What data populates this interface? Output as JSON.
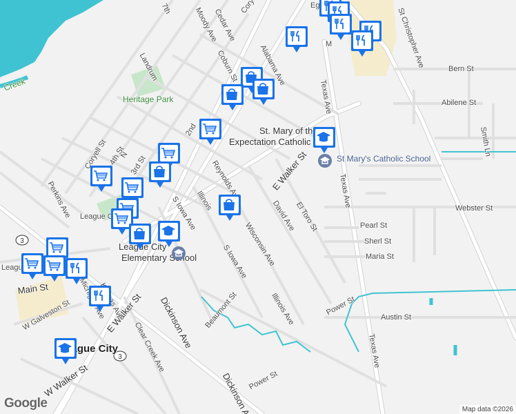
{
  "map": {
    "attribution": "Map data ©2026",
    "logo": "Google",
    "colors": {
      "background": "#f2f2f2",
      "water": "#3fc3d2",
      "park": "#c8e6c9",
      "road": "#ffffff",
      "road_outline": "#d2d2d2",
      "highway": "#dcdcdc",
      "pin": "#1a73e8",
      "creek": "#3fc3d2"
    },
    "streets": {
      "egret": "Egret B",
      "cedar": "Cedar Ave",
      "coryell_n": "Coryell St",
      "moody": "Moody Ave",
      "seventh": "7th",
      "alabama": "Alabama Ave",
      "landrum": "Landrum",
      "coburn": "Coburn St",
      "heritage": "Heritage Park",
      "second": "2nd",
      "fourth": "4th St",
      "third": "3rd St",
      "coryell_w": "Coryell St",
      "perkins": "Perkins Ave",
      "reynolds": "Reynolds Ave",
      "illinois_n": "Illinois",
      "s_iowa_n": "S Iowa Ave",
      "e_walker_ne": "E Walker St",
      "david": "David Ave",
      "el_toro": "El Toro St",
      "wisconsin": "Wisconsin Ave",
      "s_iowa_s": "S Iowa Ave",
      "illinois_s": "Illinois Ave",
      "texas_n": "Texas Ave",
      "texas_mid": "Texas Ave",
      "texas_s": "Texas Ave",
      "st_christopher": "St Christopher Ave",
      "bern": "Bern St",
      "abilene": "Abilene St",
      "smith": "Smith Ln",
      "webster": "Webster St",
      "pearl": "Pearl St",
      "sherl": "Sherl St",
      "maria": "Maria St",
      "power_e": "Power St",
      "austin": "Austin St",
      "power_s": "Power St",
      "beaumont": "Beaumont St",
      "dickinson_n": "Dickinson Ave",
      "dickinson_s": "Dickinson Ave",
      "clear_creek": "Clear Creek Ave",
      "e_walker_sw": "E Walker St",
      "main": "Main St",
      "w_galveston": "W Galveston St",
      "w_walker": "W Walker St",
      "league": "League",
      "league_city_lbl": "League City",
      "creek": "Creek",
      "route3a": "3",
      "route3b": "3",
      "m_lbl": "M",
      "kansas": "Kansas Ave",
      "michigan": "Michigan Ave",
      "n_lbl": "N"
    },
    "places": {
      "st_mary_church": "St. Mary of the Expectation Catholic",
      "st_mary_church_line1": "St. Mary of the",
      "st_mary_church_line2": "Expectation Catholic",
      "st_mary_school": "St Mary's Catholic School",
      "elem_line1": "League City",
      "elem_line2": "Elementary School",
      "league_city": "League City"
    },
    "pins": [
      {
        "icon": "restaurant-icon"
      },
      {
        "icon": "restaurant-icon"
      },
      {
        "icon": "restaurant-icon"
      },
      {
        "icon": "restaurant-icon"
      },
      {
        "icon": "restaurant-icon"
      },
      {
        "icon": "restaurant-icon"
      },
      {
        "icon": "shopping-bag-icon"
      },
      {
        "icon": "shopping-bag-icon"
      },
      {
        "icon": "shopping-bag-icon"
      },
      {
        "icon": "shopping-cart-icon"
      },
      {
        "icon": "school-icon"
      },
      {
        "icon": "shopping-cart-icon"
      },
      {
        "icon": "shopping-bag-icon"
      },
      {
        "icon": "shopping-cart-icon"
      },
      {
        "icon": "shopping-cart-icon"
      },
      {
        "icon": "shopping-cart-icon"
      },
      {
        "icon": "shopping-bag-icon"
      },
      {
        "icon": "shopping-cart-icon"
      },
      {
        "icon": "shopping-bag-icon"
      },
      {
        "icon": "school-icon"
      },
      {
        "icon": "shopping-cart-icon"
      },
      {
        "icon": "shopping-cart-icon"
      },
      {
        "icon": "shopping-cart-icon"
      },
      {
        "icon": "restaurant-icon"
      },
      {
        "icon": "restaurant-icon"
      },
      {
        "icon": "school-icon"
      }
    ]
  }
}
